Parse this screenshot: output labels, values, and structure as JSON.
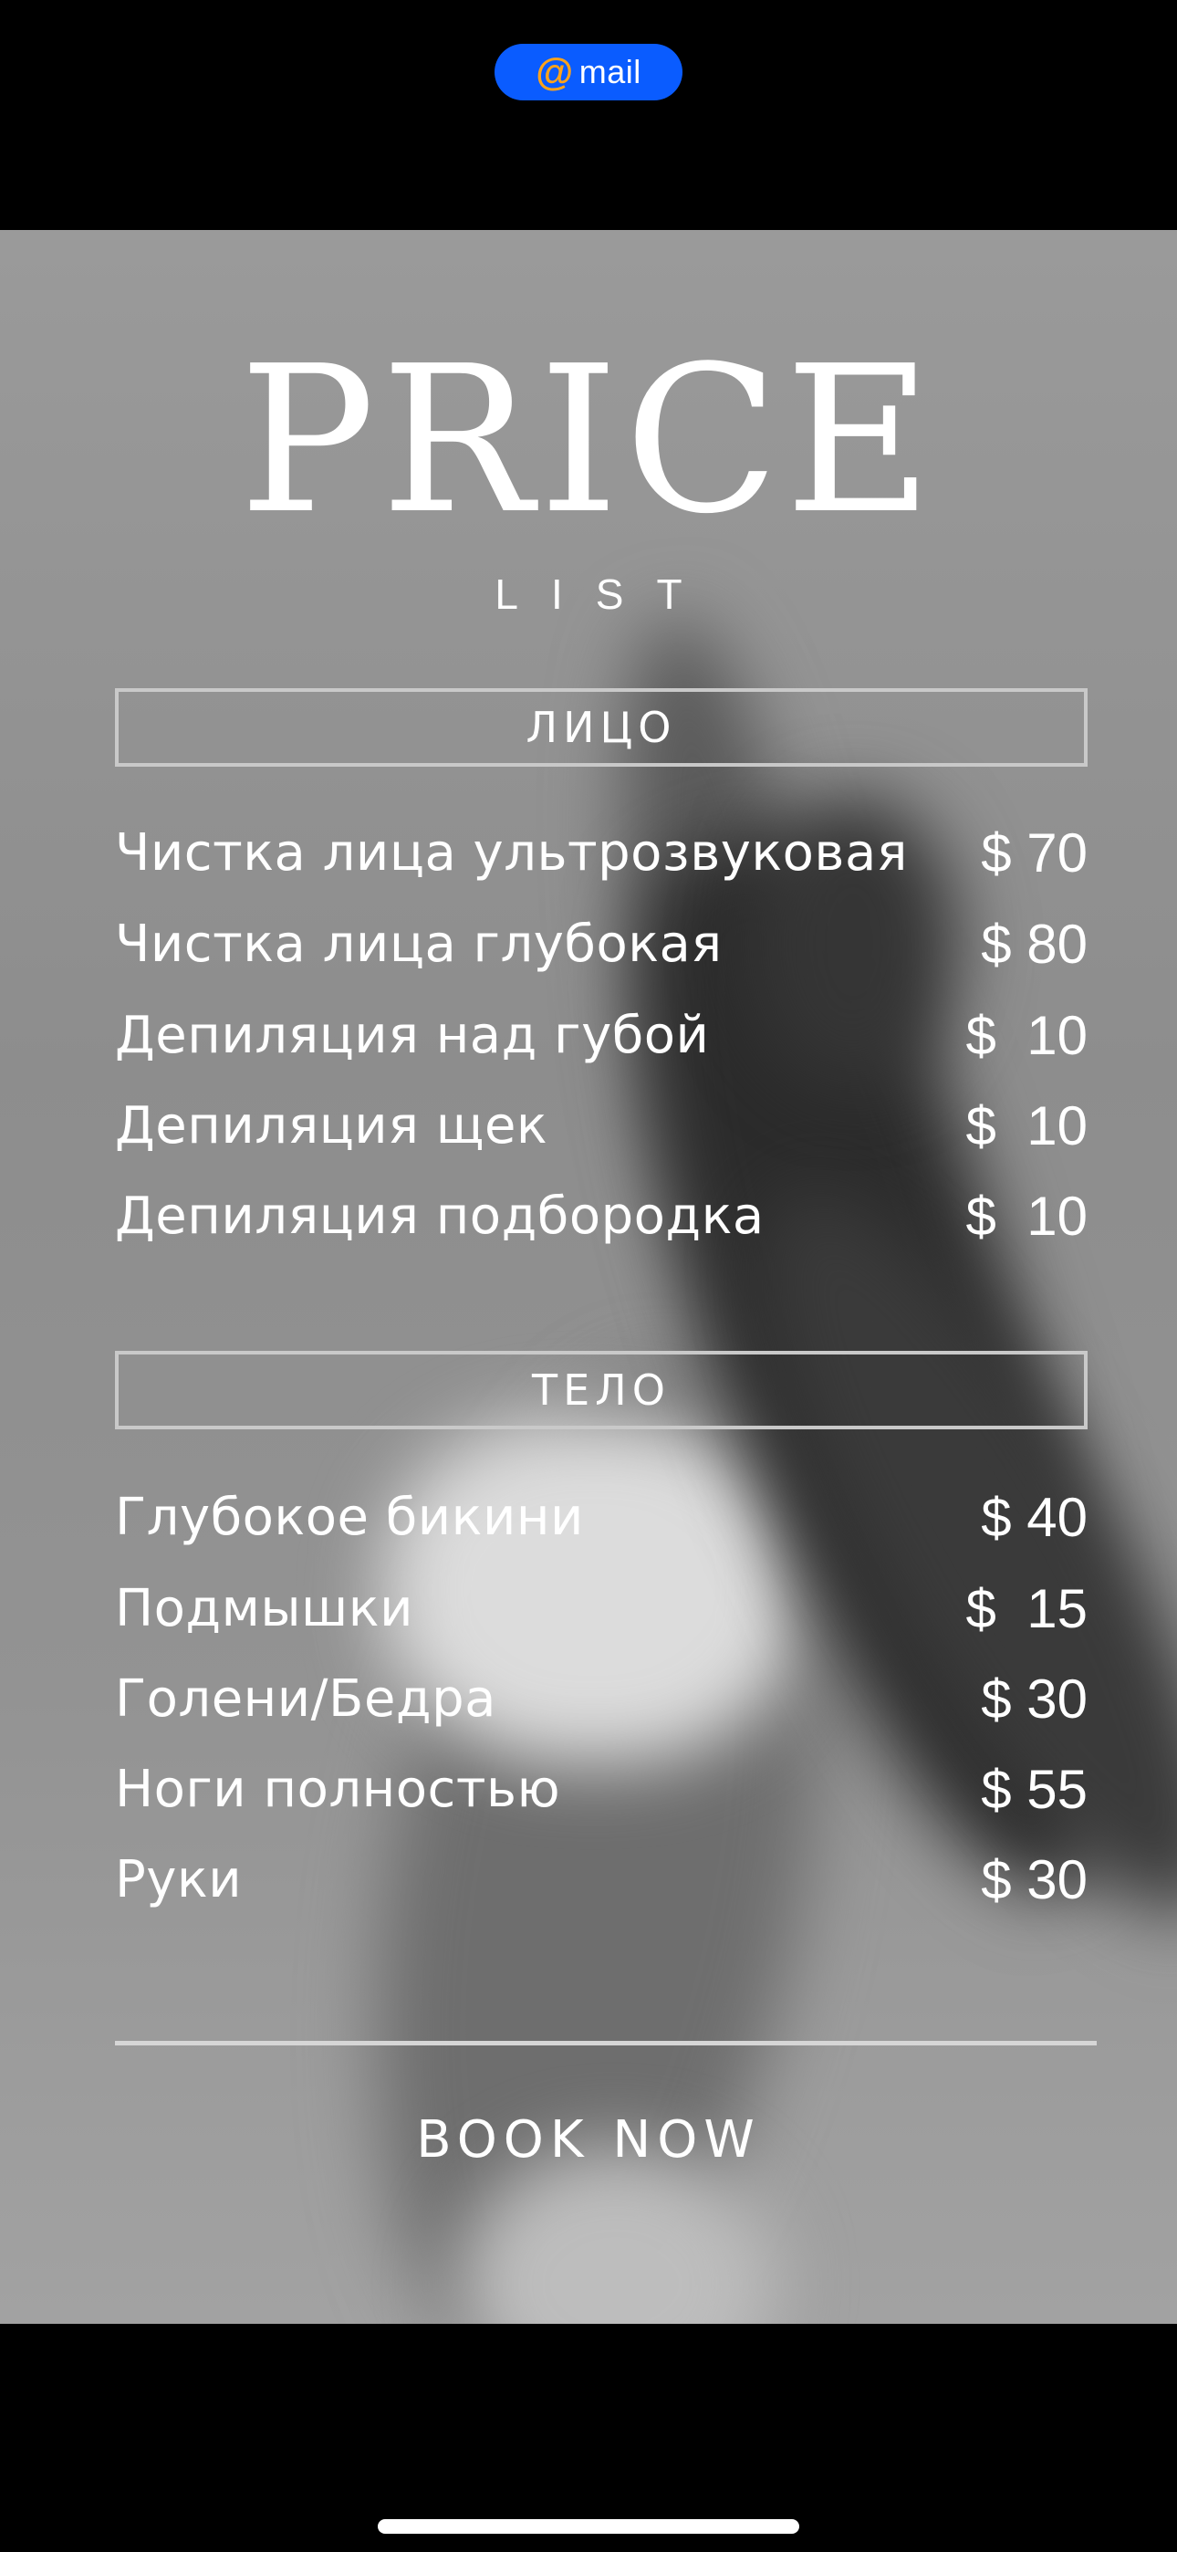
{
  "status_bar": {
    "mail_pill": {
      "at_symbol": "@",
      "label": "mail"
    }
  },
  "poster": {
    "title": "PRICE",
    "subtitle": "LIST",
    "sections": [
      {
        "heading": "ЛИЦО",
        "items": [
          {
            "name": "Чистка лица ультрозвуковая",
            "price": "$ 70"
          },
          {
            "name": "Чистка лица глубокая",
            "price": "$ 80"
          },
          {
            "name": "Депиляция над губой",
            "price": "$  10"
          },
          {
            "name": "Депиляция щек",
            "price": "$  10"
          },
          {
            "name": "Депиляция подбородка",
            "price": "$  10"
          }
        ]
      },
      {
        "heading": "ТЕЛО",
        "items": [
          {
            "name": "Глубокое бикини",
            "price": "$ 40"
          },
          {
            "name": "Подмышки",
            "price": "$  15"
          },
          {
            "name": "Голени/Бедра",
            "price": "$ 30"
          },
          {
            "name": "Ноги полностью",
            "price": "$ 55"
          },
          {
            "name": "Руки",
            "price": "$ 30"
          }
        ]
      }
    ],
    "cta": "BOOK NOW"
  },
  "colors": {
    "pill_background": "#0a5cff",
    "pill_at_symbol": "#ffa31a",
    "text": "#ffffff"
  }
}
